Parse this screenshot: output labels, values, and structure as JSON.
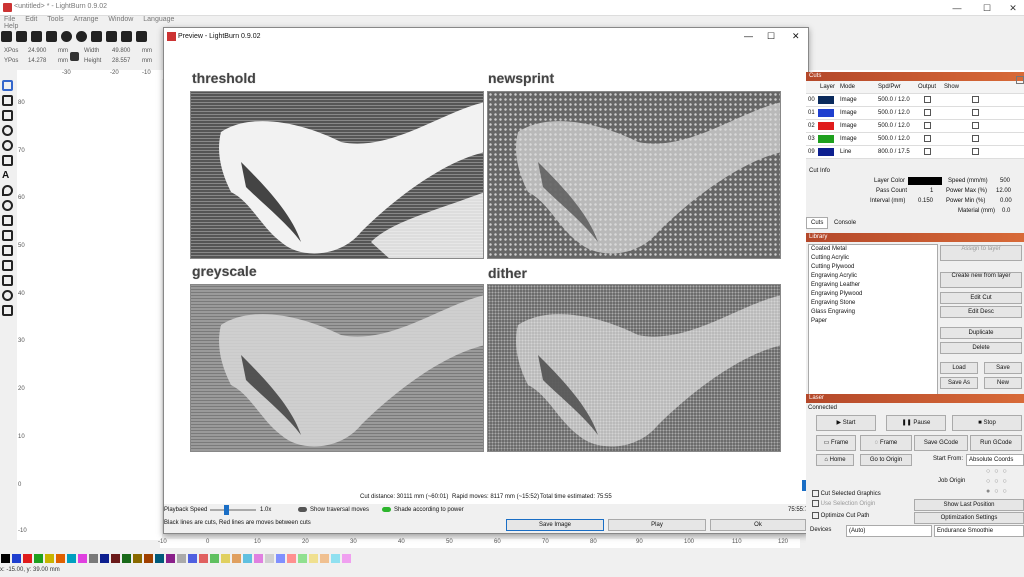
{
  "window": {
    "title": "<untitled> * - LightBurn 0.9.02"
  },
  "menu": [
    "File",
    "Edit",
    "Tools",
    "Arrange",
    "Window",
    "Language",
    "Help"
  ],
  "position": {
    "xpos_label": "XPos",
    "xpos": "24.900",
    "ypos_label": "YPos",
    "ypos": "14.278",
    "unit": "mm",
    "width_label": "Width",
    "width": "49.800",
    "height_label": "Height",
    "height": "28.557"
  },
  "preview": {
    "title": "Preview - LightBurn 0.9.02",
    "panels": [
      "threshold",
      "newsprint",
      "greyscale",
      "dither"
    ],
    "cut_distance": "Cut distance: 30111 mm (~60:01)",
    "rapid_moves": "Rapid moves: 8117 mm (~15:52)",
    "total_time": "Total time estimated: 75:55",
    "playback_label": "Playback Speed",
    "playback_value": "1.0x",
    "show_traversal": "Show traversal moves",
    "shade_power": "Shade according to power",
    "time_readout": "75:55:7",
    "legend_text": "Black lines are cuts, Red lines are moves between cuts",
    "save_image": "Save Image",
    "play": "Play",
    "ok": "Ok"
  },
  "cuts": {
    "header": "Cuts",
    "columns": [
      "#",
      "Layer",
      "Mode",
      "Spd/Pwr",
      "Output",
      "Show"
    ],
    "rows": [
      {
        "num": "00",
        "color": "#0a2a5c",
        "mode": "Image",
        "spdpwr": "500.0 / 12.0"
      },
      {
        "num": "01",
        "color": "#1f3fcf",
        "mode": "Image",
        "spdpwr": "500.0 / 12.0"
      },
      {
        "num": "02",
        "color": "#e01c1c",
        "mode": "Image",
        "spdpwr": "500.0 / 12.0"
      },
      {
        "num": "03",
        "color": "#1ea01e",
        "mode": "Image",
        "spdpwr": "500.0 / 12.0"
      },
      {
        "num": "09",
        "color": "#0d1f8f",
        "mode": "Line",
        "spdpwr": "800.0 / 17.5"
      }
    ]
  },
  "cut_info": {
    "header": "Cut Info",
    "layer_color_label": "Layer Color",
    "speed_label": "Speed (mm/m)",
    "speed": "500",
    "pass_count_label": "Pass Count",
    "pass_count": "1",
    "power_max_label": "Power Max (%)",
    "power_max": "12.00",
    "interval_label": "Interval (mm)",
    "interval": "0.150",
    "power_min_label": "Power Min (%)",
    "power_min": "0.00",
    "material_label": "Material (mm)",
    "material": "0.0"
  },
  "tabs": [
    "Cuts",
    "Console"
  ],
  "library": {
    "header": "Library",
    "items": [
      "Coated Metal",
      "Cutting Acrylic",
      "Cutting Plywood",
      "Engraving Acrylic",
      "Engraving Leather",
      "Engraving Plywood",
      "Engraving Stone",
      "Glass Engraving",
      "Paper"
    ],
    "assign": "Assign to layer",
    "create": "Create new from layer",
    "edit_cut": "Edit Cut",
    "edit_desc": "Edit Desc",
    "duplicate": "Duplicate",
    "delete": "Delete",
    "load": "Load",
    "save": "Save",
    "save_as": "Save As",
    "new": "New"
  },
  "laser": {
    "header": "Laser",
    "status": "Connected",
    "start": "Start",
    "pause": "Pause",
    "stop": "Stop",
    "frame1": "Frame",
    "frame2": "Frame",
    "save_gcode": "Save GCode",
    "run_gcode": "Run GCode",
    "home": "Home",
    "go_origin": "Go to Origin",
    "start_from_label": "Start From:",
    "start_from": "Absolute Coords",
    "job_origin": "Job Origin",
    "cut_selected": "Cut Selected Graphics",
    "use_selection": "Use Selection Origin",
    "show_last": "Show Last Position",
    "optimize": "Optimize Cut Path",
    "opt_settings": "Optimization Settings",
    "devices": "Devices",
    "auto": "(Auto)",
    "endurance": "Endurance Smoothie"
  },
  "ruler_top": [
    "-30",
    "-20",
    "-10"
  ],
  "ruler_left": [
    "80",
    "70",
    "60",
    "50",
    "40",
    "30",
    "20",
    "10",
    "0",
    "-10"
  ],
  "ruler_bottom": [
    "-10",
    "0",
    "10",
    "20",
    "30",
    "40",
    "50",
    "60",
    "70",
    "80",
    "90",
    "100",
    "110",
    "120"
  ],
  "status_bar": "x: -15.00, y: 39.00 mm",
  "palette": [
    "#000000",
    "#1f3fcf",
    "#e01c1c",
    "#1ea01e",
    "#c8b400",
    "#e06000",
    "#00a0c0",
    "#e040e0",
    "#7a7a7a",
    "#0d1f8f",
    "#6a1a1a",
    "#1a6a1a",
    "#8a6a00",
    "#a04000",
    "#005a7a",
    "#8a208a",
    "#aaaaaa",
    "#5060e0",
    "#e06060",
    "#60c060",
    "#e0d060",
    "#e0a060",
    "#60c0e0",
    "#e080e0",
    "#d0d0d0",
    "#8090ff",
    "#ff9090",
    "#90e090",
    "#f0e090",
    "#f0c090",
    "#90e0f0",
    "#f0a0f0"
  ]
}
